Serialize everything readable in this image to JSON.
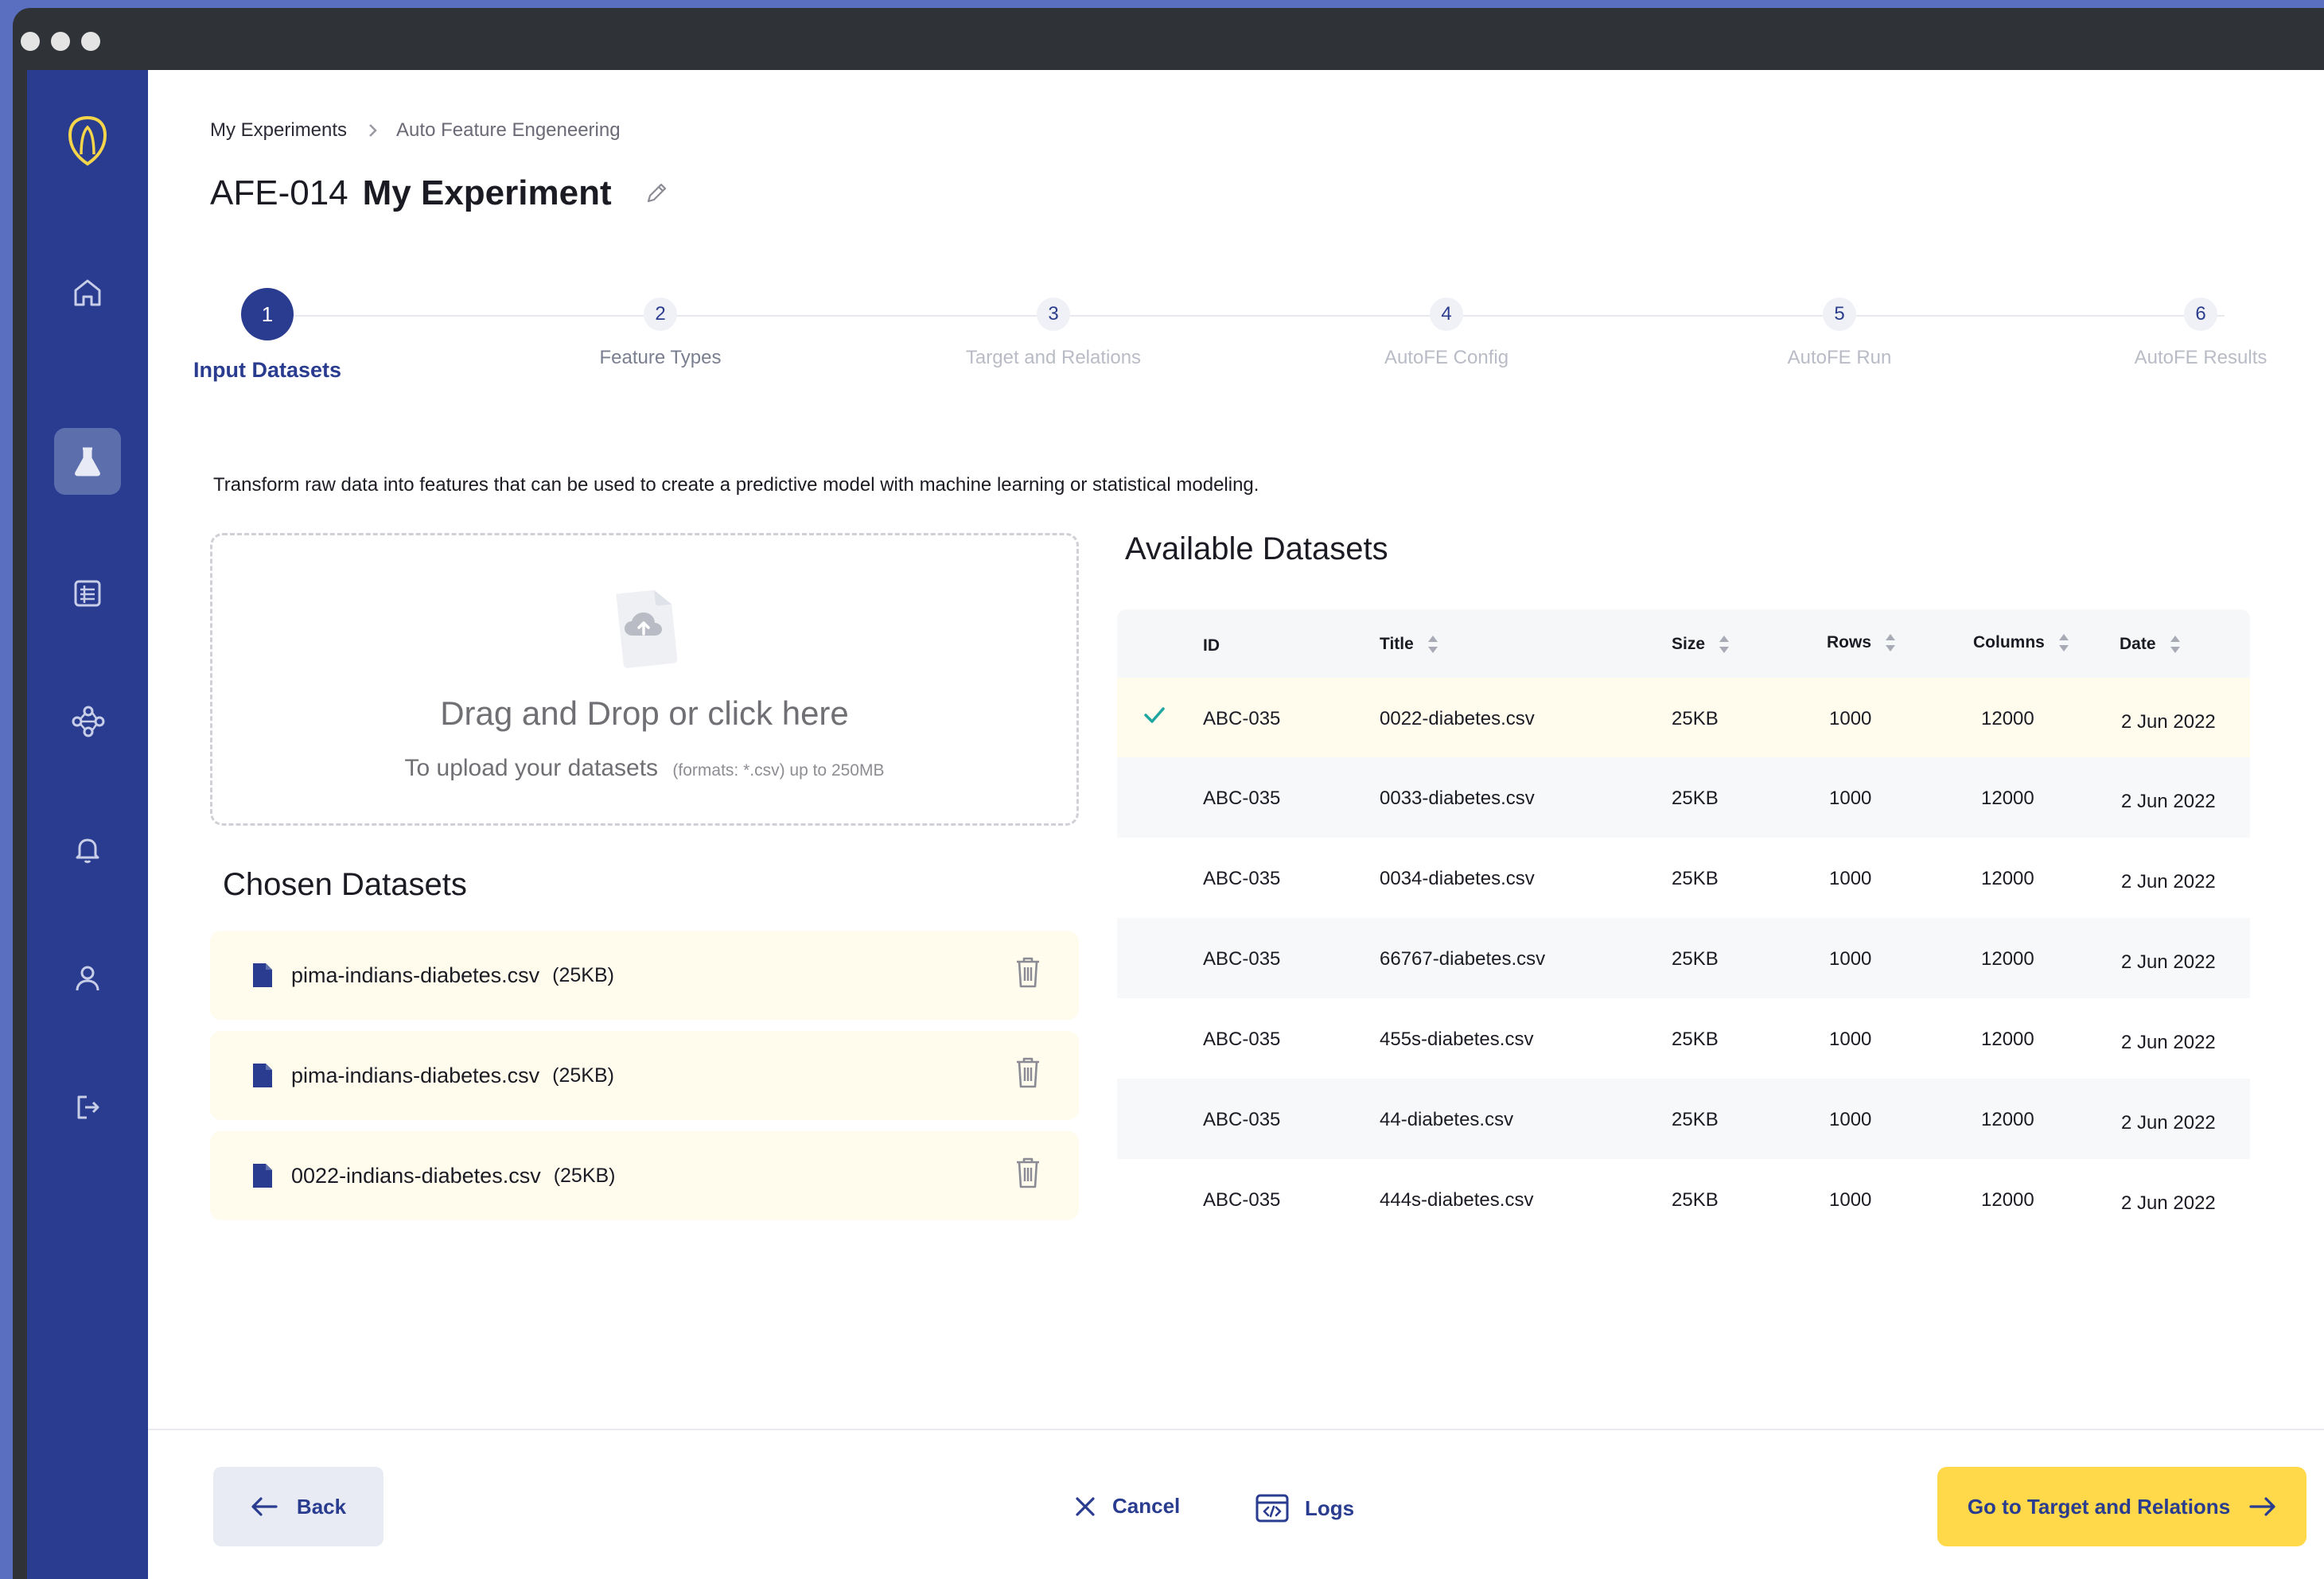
{
  "breadcrumb": {
    "parent": "My Experiments",
    "current": "Auto Feature Engeneering"
  },
  "experiment": {
    "code": "AFE-014",
    "name": "My Experiment"
  },
  "steps": [
    {
      "number": "1",
      "label": "Input Datasets"
    },
    {
      "number": "2",
      "label": "Feature Types"
    },
    {
      "number": "3",
      "label": "Target and Relations"
    },
    {
      "number": "4",
      "label": "AutoFE Config"
    },
    {
      "number": "5",
      "label": "AutoFE Run"
    },
    {
      "number": "6",
      "label": "AutoFE Results"
    }
  ],
  "intro_text": "Transform raw data into features that can be used to create a predictive model with machine learning or statistical modeling.",
  "dropzone": {
    "title": "Drag and Drop or click here",
    "subtitle": "To upload your datasets",
    "formats": "(formats: *.csv) up to 250MB"
  },
  "chosen": {
    "title": "Chosen Datasets",
    "items": [
      {
        "name": "pima-indians-diabetes.csv",
        "size": "(25KB)"
      },
      {
        "name": "pima-indians-diabetes.csv",
        "size": "(25KB)"
      },
      {
        "name": "0022-indians-diabetes.csv",
        "size": "(25KB)"
      }
    ]
  },
  "available": {
    "title": "Available Datasets",
    "columns": [
      "ID",
      "Title",
      "Size",
      "Rows",
      "Columns",
      "Date"
    ],
    "rows": [
      {
        "id": "ABC-035",
        "title": "0022-diabetes.csv",
        "size": "25KB",
        "rows": "1000",
        "columns": "12000",
        "date": "2 Jun 2022",
        "selected": true
      },
      {
        "id": "ABC-035",
        "title": "0033-diabetes.csv",
        "size": "25KB",
        "rows": "1000",
        "columns": "12000",
        "date": "2 Jun 2022",
        "selected": false
      },
      {
        "id": "ABC-035",
        "title": "0034-diabetes.csv",
        "size": "25KB",
        "rows": "1000",
        "columns": "12000",
        "date": "2 Jun 2022",
        "selected": false
      },
      {
        "id": "ABC-035",
        "title": "66767-diabetes.csv",
        "size": "25KB",
        "rows": "1000",
        "columns": "12000",
        "date": "2 Jun 2022",
        "selected": false
      },
      {
        "id": "ABC-035",
        "title": "455s-diabetes.csv",
        "size": "25KB",
        "rows": "1000",
        "columns": "12000",
        "date": "2 Jun 2022",
        "selected": false
      },
      {
        "id": "ABC-035",
        "title": "44-diabetes.csv",
        "size": "25KB",
        "rows": "1000",
        "columns": "12000",
        "date": "2 Jun 2022",
        "selected": false
      },
      {
        "id": "ABC-035",
        "title": "444s-diabetes.csv",
        "size": "25KB",
        "rows": "1000",
        "columns": "12000",
        "date": "2 Jun 2022",
        "selected": false
      }
    ]
  },
  "footer": {
    "back_label": "Back",
    "cancel_label": "Cancel",
    "logs_label": "Logs",
    "next_label": "Go to Target and Relations"
  },
  "icons": {
    "sidebar": [
      "home-icon",
      "flask-icon",
      "list-icon",
      "network-icon",
      "bell-icon",
      "user-icon",
      "logout-icon"
    ],
    "logo": "shield-logo-icon"
  },
  "colors": {
    "sidebar": "#293c8f",
    "accent": "#ffd94a",
    "selected_row": "#fffbed",
    "check": "#1fa6a0"
  }
}
